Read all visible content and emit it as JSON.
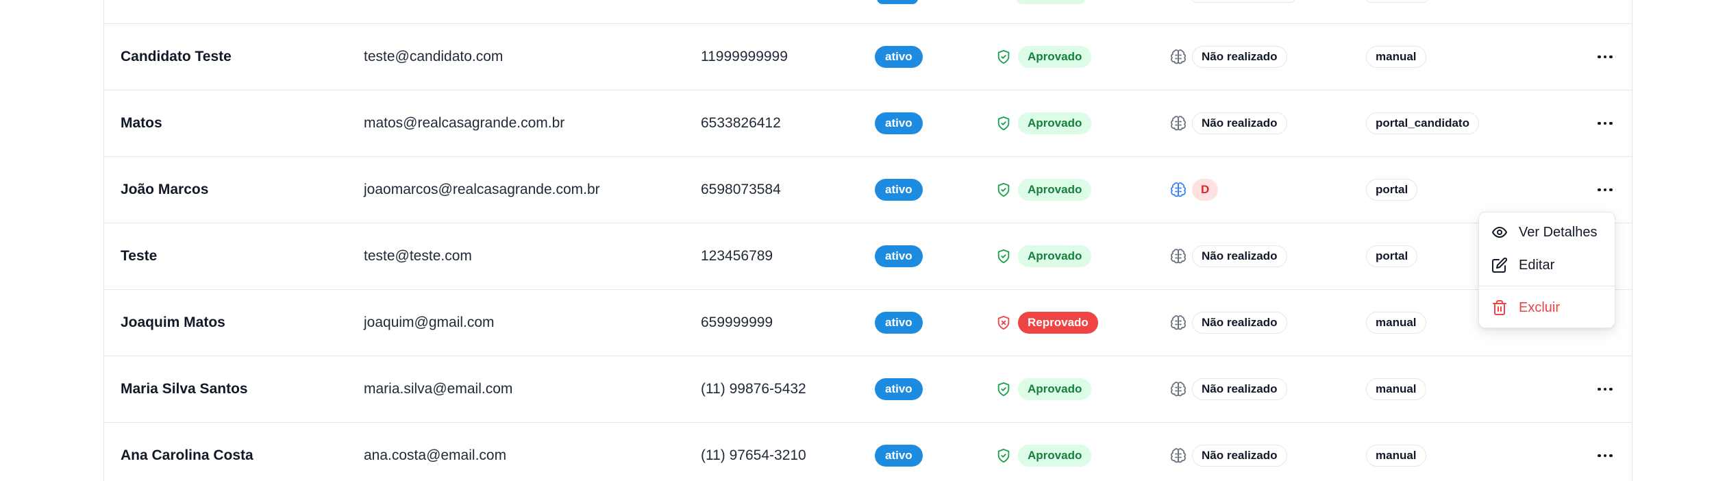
{
  "rows": [
    {
      "name": "Candidato Teste",
      "email": "teste@candidato.com",
      "phone": "11999999999",
      "status": "ativo",
      "approval": "Aprovado",
      "approval_state": "approved",
      "test": "Não realizado",
      "test_state": "pending",
      "origin": "manual"
    },
    {
      "name": "Matos",
      "email": "matos@realcasagrande.com.br",
      "phone": "6533826412",
      "status": "ativo",
      "approval": "Aprovado",
      "approval_state": "approved",
      "test": "Não realizado",
      "test_state": "pending",
      "origin": "portal_candidato"
    },
    {
      "name": "João Marcos",
      "email": "joaomarcos@realcasagrande.com.br",
      "phone": "6598073584",
      "status": "ativo",
      "approval": "Aprovado",
      "approval_state": "approved",
      "test": "D",
      "test_state": "done",
      "origin": "portal"
    },
    {
      "name": "Teste",
      "email": "teste@teste.com",
      "phone": "123456789",
      "status": "ativo",
      "approval": "Aprovado",
      "approval_state": "approved",
      "test": "Não realizado",
      "test_state": "pending",
      "origin": "portal"
    },
    {
      "name": "Joaquim Matos",
      "email": "joaquim@gmail.com",
      "phone": "659999999",
      "status": "ativo",
      "approval": "Reprovado",
      "approval_state": "rejected",
      "test": "Não realizado",
      "test_state": "pending",
      "origin": "manual"
    },
    {
      "name": "Maria Silva Santos",
      "email": "maria.silva@email.com",
      "phone": "(11) 99876-5432",
      "status": "ativo",
      "approval": "Aprovado",
      "approval_state": "approved",
      "test": "Não realizado",
      "test_state": "pending",
      "origin": "manual"
    },
    {
      "name": "Ana Carolina Costa",
      "email": "ana.costa@email.com",
      "phone": "(11) 97654-3210",
      "status": "ativo",
      "approval": "Aprovado",
      "approval_state": "approved",
      "test": "Não realizado",
      "test_state": "pending",
      "origin": "manual"
    }
  ],
  "row_menu": {
    "open_for_row": 2,
    "items": [
      {
        "label": "Ver Detalhes",
        "icon": "eye-icon"
      },
      {
        "label": "Editar",
        "icon": "edit-icon"
      },
      {
        "label": "Excluir",
        "icon": "trash-icon"
      }
    ]
  },
  "colors": {
    "status_active": "#1d8ce0",
    "approved_bg": "#dcfce7",
    "approved_text": "#15803d",
    "rejected": "#ef4444",
    "test_done_icon": "#3b82f6",
    "border": "#e5e7eb"
  }
}
